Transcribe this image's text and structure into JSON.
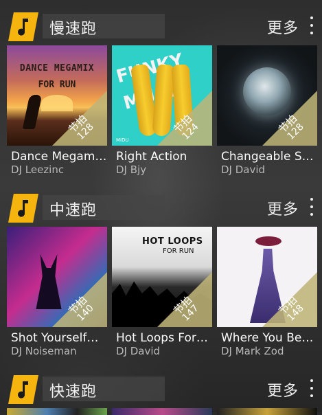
{
  "colors": {
    "accent": "#f6b40f",
    "bpm_badge": "#beb478",
    "artist_text": "#b8b8b8"
  },
  "more_label": "更多",
  "bpm_label": "节拍",
  "sections": [
    {
      "title": "慢速跑",
      "icon": "music-note-icon",
      "tracks": [
        {
          "title": "Dance Megam…",
          "artist": "DJ Leezinc",
          "bpm": "128",
          "cover_text_1": "DANCE MEGAMIX",
          "cover_text_2": "FOR RUN"
        },
        {
          "title": "Right Action",
          "artist": "DJ Bjy",
          "bpm": "124",
          "cover_text_1": "FUNKY MUSIC",
          "cover_text_2": "MIDU"
        },
        {
          "title": "Changeable S…",
          "artist": "DJ David",
          "bpm": "128"
        }
      ]
    },
    {
      "title": "中速跑",
      "icon": "music-note-icon",
      "tracks": [
        {
          "title": "Shot Yourself…",
          "artist": "DJ Noiseman",
          "bpm": "140"
        },
        {
          "title": "Hot Loops For…",
          "artist": "DJ David",
          "bpm": "147",
          "cover_text_1": "HOT LOOPS",
          "cover_text_2": "FOR RUN"
        },
        {
          "title": "Where You Be…",
          "artist": "DJ Mark Zod",
          "bpm": "148"
        }
      ]
    },
    {
      "title": "快速跑",
      "icon": "music-note-icon"
    }
  ]
}
